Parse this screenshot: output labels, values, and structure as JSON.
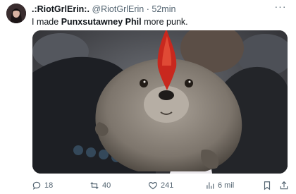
{
  "tweet": {
    "display_name": ".:RiotGrlErin:.",
    "handle": "@RiotGrlErin",
    "separator": "·",
    "time": "52min",
    "text_prefix": "I made ",
    "text_bold": "Punxsutawney Phil",
    "text_suffix": " more punk.",
    "more_label": "···"
  },
  "actions": {
    "replies": "18",
    "reposts": "40",
    "likes": "241",
    "views": "6 mil"
  },
  "icons": {
    "more": "more-icon",
    "reply": "reply-icon",
    "repost": "repost-icon",
    "like": "heart-icon",
    "views": "views-icon",
    "bookmark": "bookmark-icon",
    "share": "share-icon"
  },
  "colors": {
    "text": "#0f1419",
    "muted": "#536471",
    "mohawk": "#c8281e"
  }
}
